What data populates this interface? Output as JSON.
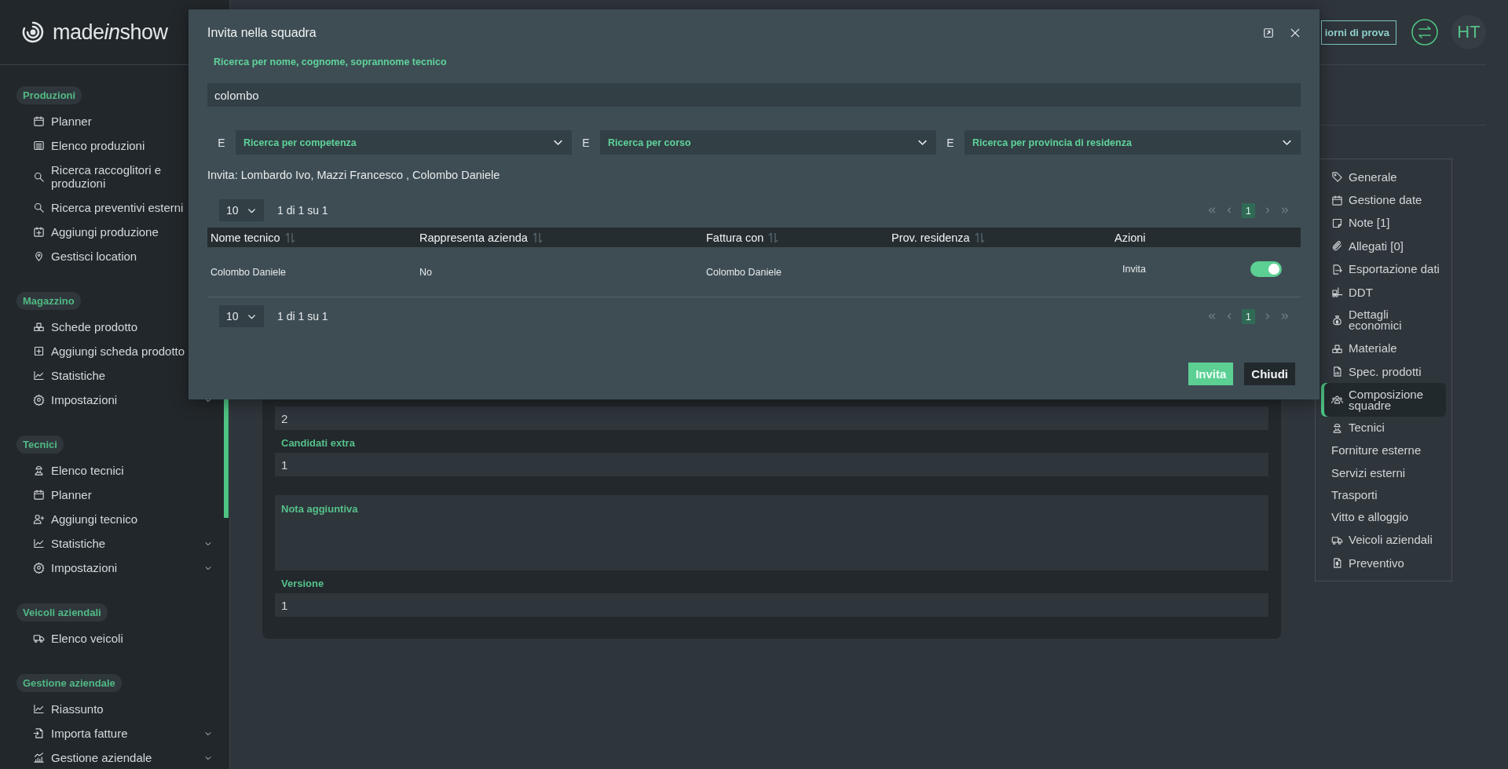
{
  "brand": {
    "name": [
      {
        "text": "made",
        "italic": false
      },
      {
        "text": "in",
        "italic": true
      },
      {
        "text": "show",
        "italic": false
      }
    ]
  },
  "sidebar": {
    "sections": [
      {
        "title": "Produzioni",
        "items": [
          {
            "label": "Planner",
            "kind": "link"
          },
          {
            "label": "Elenco produzioni",
            "kind": "link"
          },
          {
            "label": "Ricerca raccoglitori e produzioni",
            "kind": "link"
          },
          {
            "label": "Ricerca preventivi esterni",
            "kind": "link"
          },
          {
            "label": "Aggiungi produzione",
            "kind": "link"
          },
          {
            "label": "Gestisci location",
            "kind": "link"
          }
        ]
      },
      {
        "title": "Magazzino",
        "items": [
          {
            "label": "Schede prodotto",
            "kind": "link"
          },
          {
            "label": "Aggiungi scheda prodotto",
            "kind": "link"
          },
          {
            "label": "Statistiche",
            "kind": "link"
          },
          {
            "label": "Impostazioni",
            "kind": "submenu"
          }
        ]
      },
      {
        "title": "Tecnici",
        "items": [
          {
            "label": "Elenco tecnici",
            "kind": "link"
          },
          {
            "label": "Planner",
            "kind": "link"
          },
          {
            "label": "Aggiungi tecnico",
            "kind": "link"
          },
          {
            "label": "Statistiche",
            "kind": "submenu"
          },
          {
            "label": "Impostazioni",
            "kind": "submenu"
          }
        ]
      },
      {
        "title": "Veicoli aziendali",
        "items": [
          {
            "label": "Elenco veicoli",
            "kind": "link"
          }
        ]
      },
      {
        "title": "Gestione aziendale",
        "items": [
          {
            "label": "Riassunto",
            "kind": "link"
          },
          {
            "label": "Importa fatture",
            "kind": "submenu"
          },
          {
            "label": "Gestione aziendale",
            "kind": "submenu"
          }
        ]
      }
    ]
  },
  "header": {
    "trial_button": "iorni di prova",
    "avatar": "HT"
  },
  "form": {
    "fields": [
      {
        "kind": "input",
        "value": "2"
      },
      {
        "kind": "input",
        "label": "Candidati extra",
        "value": "1"
      },
      {
        "kind": "textarea",
        "label": "Nota aggiuntiva"
      },
      {
        "kind": "input",
        "label": "Versione",
        "value": "1"
      }
    ]
  },
  "section_nav": {
    "items": [
      {
        "label": "Generale",
        "selected": false
      },
      {
        "label": "Gestione date",
        "selected": false
      },
      {
        "label": "Note [1]",
        "selected": false
      },
      {
        "label": "Allegati [0]",
        "selected": false
      },
      {
        "label": "Esportazione dati",
        "selected": false
      },
      {
        "label": "DDT",
        "selected": false
      },
      {
        "label": "Dettagli economici",
        "selected": false
      },
      {
        "label": "Materiale",
        "selected": false
      },
      {
        "label": "Spec. prodotti",
        "selected": false
      },
      {
        "label": "Composizione squadre",
        "selected": true
      },
      {
        "label": "Tecnici",
        "selected": false
      },
      {
        "label": "Forniture esterne",
        "selected": false
      },
      {
        "label": "Servizi esterni",
        "selected": false
      },
      {
        "label": "Trasporti",
        "selected": false
      },
      {
        "label": "Vitto e alloggio",
        "selected": false
      },
      {
        "label": "Veicoli aziendali",
        "selected": false
      },
      {
        "label": "Preventivo",
        "selected": false
      }
    ]
  },
  "modal": {
    "title": "Invita nella squadra",
    "search": {
      "label": "Ricerca per nome, cognome, soprannome tecnico",
      "value": "colombo"
    },
    "filters": [
      {
        "conjunction": "E",
        "label": "Ricerca per competenza"
      },
      {
        "conjunction": "E",
        "label": "Ricerca per corso"
      },
      {
        "conjunction": "E",
        "label": "Ricerca per provincia di residenza"
      }
    ],
    "invite_summary": "Invita: Lombardo Ivo, Mazzi Francesco , Colombo Daniele",
    "pagination_top": {
      "page_size": "10",
      "range": "1 di 1 su 1",
      "pages": [
        {
          "label": "1",
          "selected": true
        }
      ]
    },
    "table": {
      "columns": [
        {
          "label": "Nome tecnico",
          "sortable": true
        },
        {
          "label": "Rappresenta azienda",
          "sortable": true
        },
        {
          "label": "Fattura con",
          "sortable": true
        },
        {
          "label": "Prov. residenza",
          "sortable": true
        },
        {
          "label": "Azioni",
          "sortable": false
        }
      ],
      "rows": [
        {
          "nome": "Colombo Daniele",
          "rappresenta": "No",
          "fattura": "Colombo Daniele",
          "action": "Invita",
          "on": true
        }
      ]
    },
    "pagination_bottom": {
      "page_size": "10",
      "range": "1 di 1 su 1",
      "pages": [
        {
          "label": "1",
          "selected": true
        }
      ]
    },
    "buttons": [
      {
        "label": "Invita",
        "kind": "primary"
      },
      {
        "label": "Chiudi",
        "kind": "secondary"
      }
    ]
  }
}
